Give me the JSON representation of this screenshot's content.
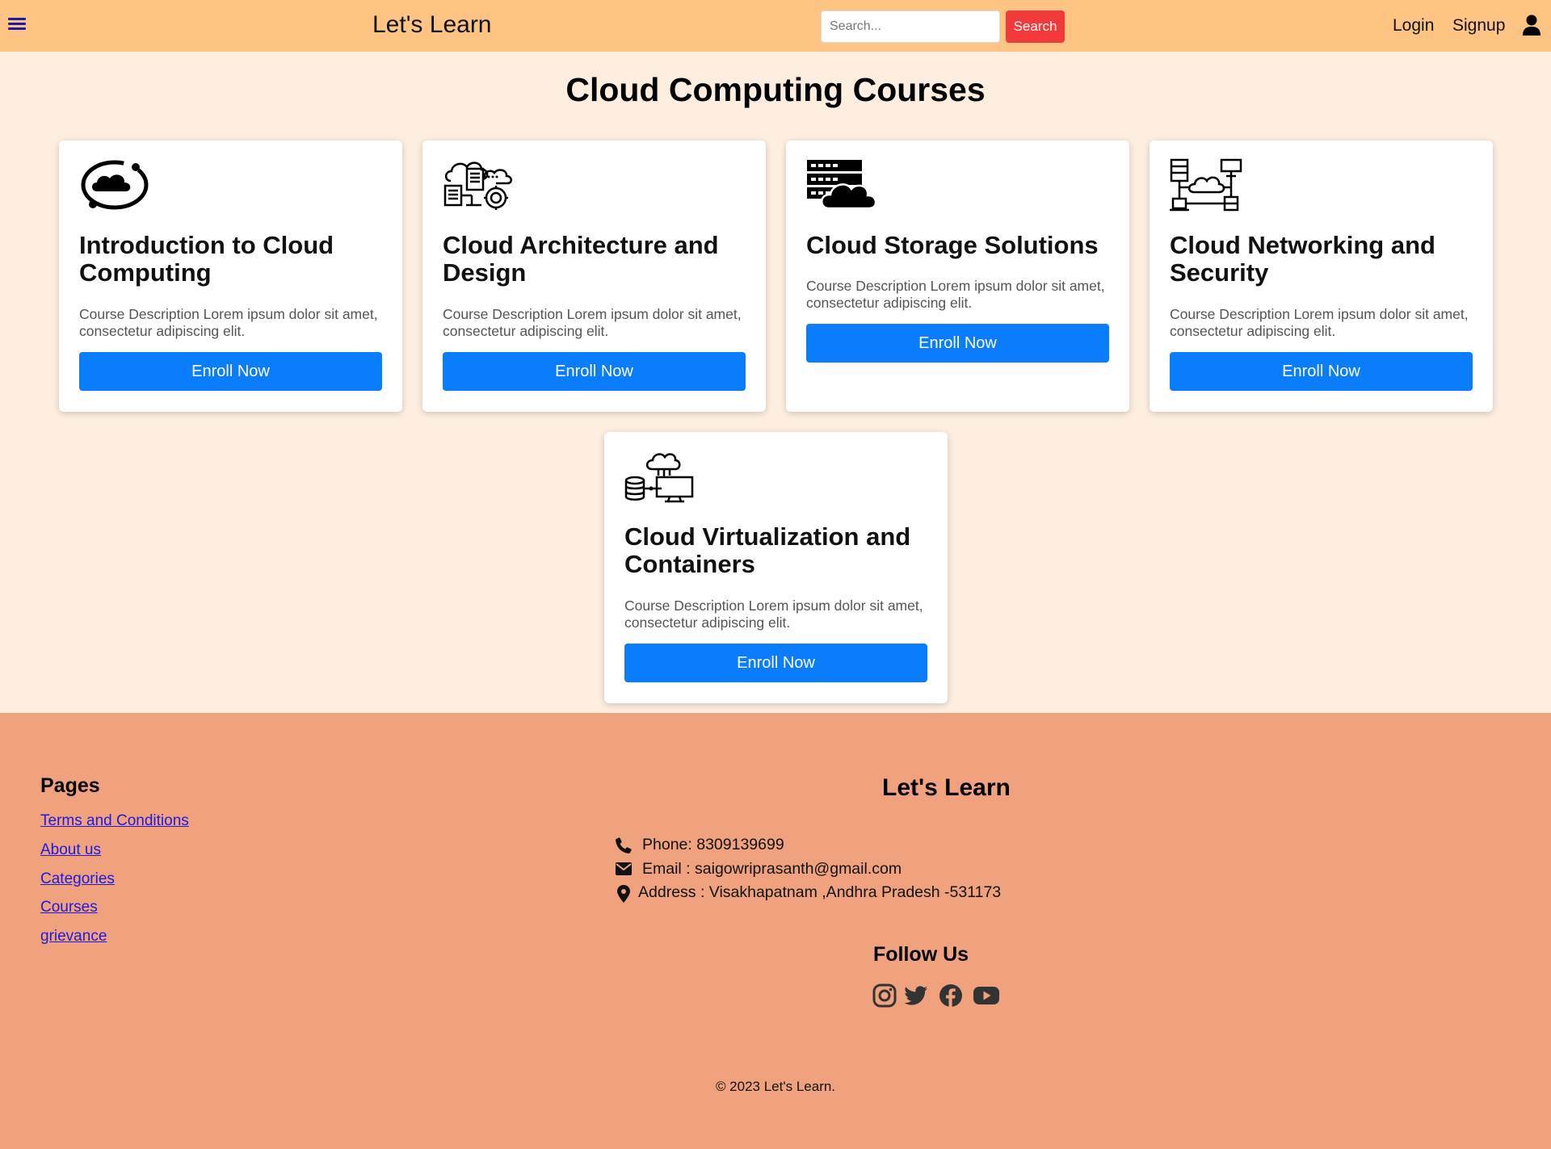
{
  "header": {
    "brand": "Let's Learn",
    "search_placeholder": "Search...",
    "search_button": "Search",
    "login": "Login",
    "signup": "Signup"
  },
  "main": {
    "title": "Cloud Computing Courses",
    "courses": [
      {
        "title": "Introduction to Cloud Computing",
        "description": "Course Description Lorem ipsum dolor sit amet, consectetur adipiscing elit.",
        "button": "Enroll Now",
        "icon": "cloud-orbit-icon"
      },
      {
        "title": "Cloud Architecture and Design",
        "description": "Course Description Lorem ipsum dolor sit amet, consectetur adipiscing elit.",
        "button": "Enroll Now",
        "icon": "cloud-architecture-icon"
      },
      {
        "title": "Cloud Storage Solutions",
        "description": "Course Description Lorem ipsum dolor sit amet, consectetur adipiscing elit.",
        "button": "Enroll Now",
        "icon": "cloud-storage-icon"
      },
      {
        "title": "Cloud Networking and Security",
        "description": "Course Description Lorem ipsum dolor sit amet, consectetur adipiscing elit.",
        "button": "Enroll Now",
        "icon": "cloud-network-icon"
      },
      {
        "title": "Cloud Virtualization and Containers",
        "description": "Course Description Lorem ipsum dolor sit amet, consectetur adipiscing elit.",
        "button": "Enroll Now",
        "icon": "cloud-virtualization-icon"
      }
    ]
  },
  "footer": {
    "pages_title": "Pages",
    "links": [
      "Terms and Conditions",
      "About us",
      "Categories",
      "Courses",
      "grievance"
    ],
    "brand": "Let's Learn",
    "phone": "Phone: 8309139699",
    "email": "Email : saigowriprasanth@gmail.com",
    "address": "Address : Visakhapatnam ,Andhra Pradesh -531173",
    "follow_title": "Follow Us",
    "social": [
      "instagram-icon",
      "twitter-icon",
      "facebook-icon",
      "youtube-icon"
    ],
    "copyright": "© 2023 Let's Learn."
  },
  "colors": {
    "navbar": "#fdc484",
    "page_bg": "#fdeee0",
    "footer": "#efa27d",
    "accent_button": "#0a7dfc",
    "search_button": "#f33a3a",
    "link": "#1d1ae0"
  }
}
